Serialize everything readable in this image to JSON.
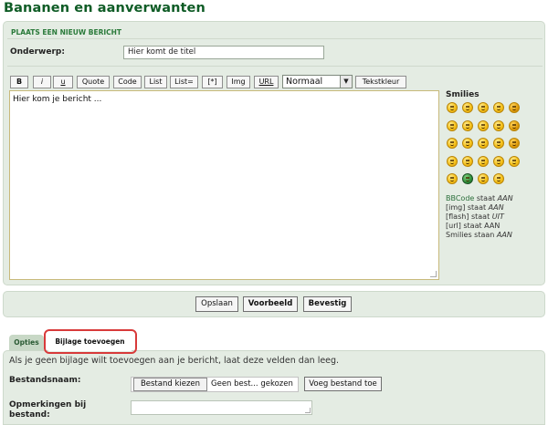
{
  "page": {
    "title": "Bananen en aanverwanten"
  },
  "post_form": {
    "heading": "PLAATS EEN NIEUW BERICHT",
    "subject": {
      "label": "Onderwerp:",
      "value": "Hier komt de titel"
    },
    "toolbar": {
      "bold": "B",
      "italic": "i",
      "underline": "u",
      "quote": "Quote",
      "code": "Code",
      "list": "List",
      "list_numbered": "List=",
      "list_item": "[*]",
      "img": "Img",
      "url": "URL",
      "font_size": {
        "selected": "Normaal"
      },
      "text_color": "Tekstkleur"
    },
    "message": {
      "value": "Hier kom je bericht ..."
    }
  },
  "smilies": {
    "title": "Smilies",
    "icons": [
      "smiley-grin-icon",
      "smiley-happy-icon",
      "smiley-wink-icon",
      "smiley-cool-icon",
      "smiley-shocked-icon",
      "smiley-confused-icon",
      "smiley-sad-icon",
      "smiley-sunglasses-icon",
      "smiley-laugh-icon",
      "smiley-evil-icon",
      "smiley-angry-icon",
      "smiley-mad-icon",
      "smiley-neutral-icon",
      "smiley-surprised-icon",
      "smiley-devil-icon",
      "smiley-tongue-icon",
      "smiley-exclaim-icon",
      "smiley-question-icon",
      "smiley-idea-icon",
      "smiley-arrow-icon",
      "smiley-puzzled-icon",
      "smiley-alien-icon",
      "smiley-nerd-icon",
      "smiley-geek-icon"
    ]
  },
  "status": {
    "bbcode_link": "BBCode",
    "bbcode_text": "staat",
    "bbcode_value": "AAN",
    "img_text": "[img] staat",
    "img_value": "AAN",
    "flash_text": "[flash] staat",
    "flash_value": "UIT",
    "url_text": "[url] staat AAN",
    "smilies_text": "Smilies staan",
    "smilies_value": "AAN"
  },
  "actions": {
    "save": "Opslaan",
    "preview": "Voorbeeld",
    "confirm": "Bevestig"
  },
  "tabs": [
    {
      "label": "Opties",
      "active": false
    },
    {
      "label": "Bijlage toevoegen",
      "active": true
    }
  ],
  "attachment": {
    "intro": "Als je geen bijlage wilt toevoegen aan je bericht, laat deze velden dan leeg.",
    "filename_label": "Bestandsnaam:",
    "choose_button": "Bestand kiezen",
    "no_file_text": "Geen best... gekozen",
    "add_button": "Voeg bestand toe",
    "remarks_label_line1": "Opmerkingen bij",
    "remarks_label_line2": "bestand:"
  },
  "colors": {
    "title_green": "#0f5c26",
    "panel_bg": "#e4ece3",
    "heading_green": "#2a7a3a",
    "highlight_red": "#d83a3a"
  }
}
